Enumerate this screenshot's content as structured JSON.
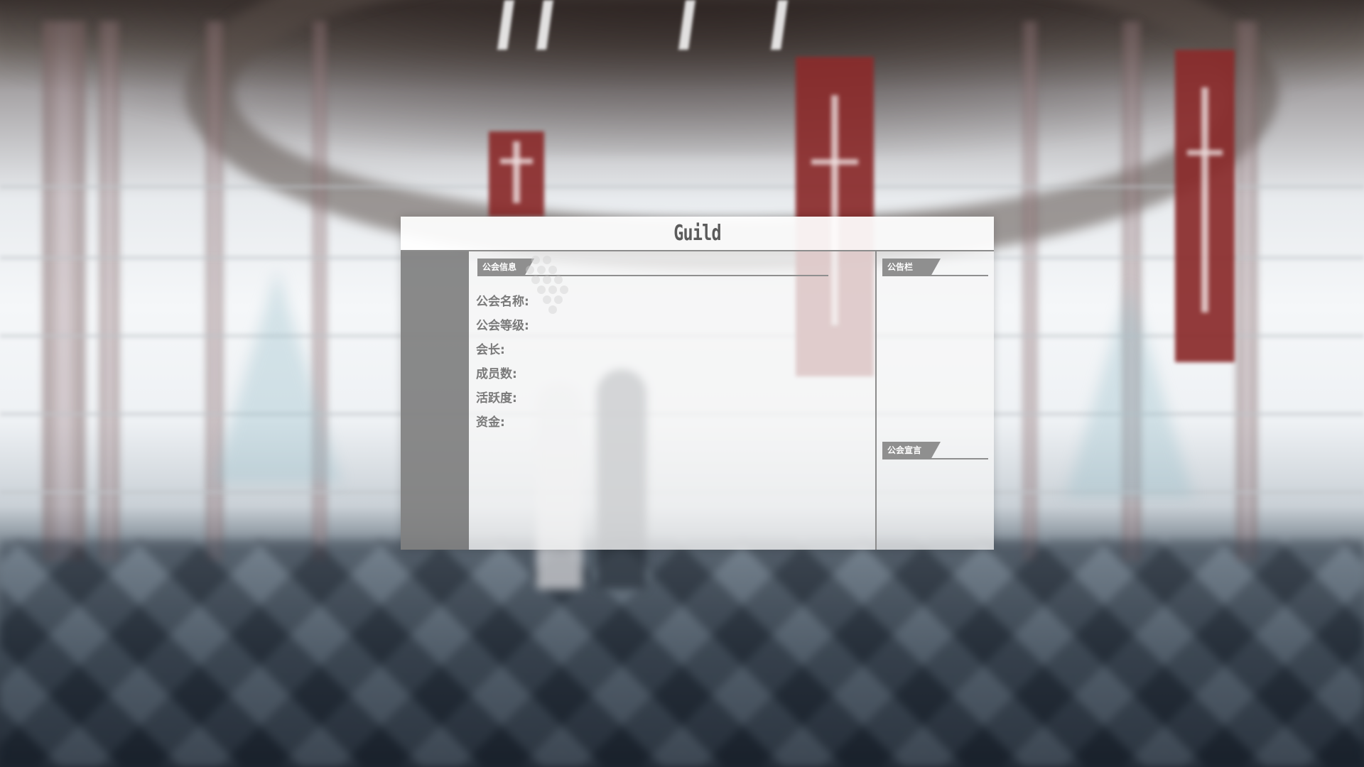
{
  "window": {
    "title": "Guild"
  },
  "guild_info": {
    "section_title": "公会信息",
    "fields": [
      {
        "label": "公会名称:",
        "value": ""
      },
      {
        "label": "公会等级:",
        "value": ""
      },
      {
        "label": "会长:",
        "value": ""
      },
      {
        "label": "成员数:",
        "value": ""
      },
      {
        "label": "活跃度:",
        "value": ""
      },
      {
        "label": "资金:",
        "value": ""
      }
    ]
  },
  "bulletin": {
    "section_title": "公告栏"
  },
  "declaration": {
    "section_title": "公会宣言"
  },
  "colors": {
    "panel_header_bg": "#ffffff",
    "sidebar_bg": "#808080",
    "tab_bg": "#8f8f8f",
    "label_text": "#7a7a7a",
    "banner_red": "#8a2b2b"
  }
}
